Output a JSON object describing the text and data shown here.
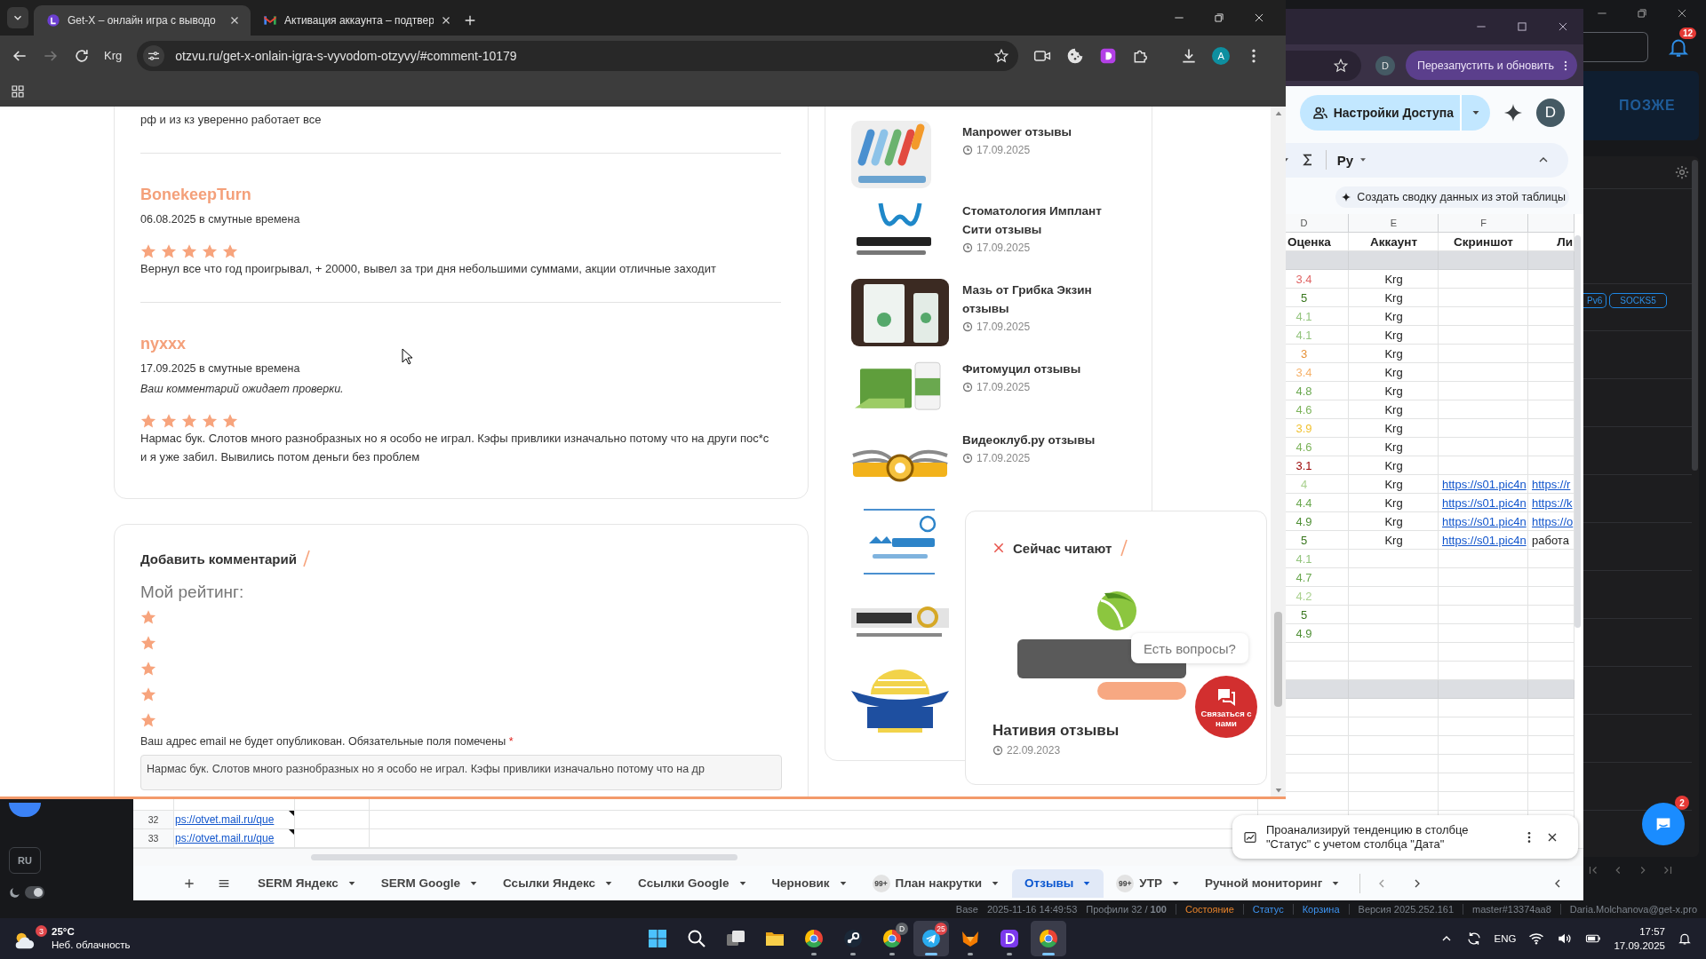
{
  "browser": {
    "tabs": [
      {
        "kind": "round",
        "title": "Get-X – онлайн игра с выводо",
        "selected": true
      },
      {
        "kind": "mail",
        "title": "Активация аккаунта – подтвер",
        "selected": false
      }
    ],
    "forward_disabled": true,
    "toolbar_label": "Krg",
    "address": "otzvu.ru/get-x-onlain-igra-s-vyvodom-otzyvy/#comment-10179",
    "avatar": "A"
  },
  "comments": [
    {
      "kind": "excerpt",
      "text": "рф и из кз уверенно работает все"
    },
    {
      "kind": "review",
      "author": "BonekeepTurn",
      "date": "06.08.2025 в смутные времена",
      "stars": 5,
      "text": "Вернул все что год проигрывал, + 20000, вывел за три дня небольшими суммами, акции отличные заходит"
    },
    {
      "kind": "review",
      "author": "nyxxx",
      "date": "17.09.2025 в смутные времена",
      "note": "Ваш комментарий ожидает проверки.",
      "stars": 5,
      "text": "Нармас бук. Слотов много разнобразных но я особо не играл. Кэфы привлики изначально потому что на други пос*с и я уже забил. Вывились потом деньги без проблем"
    }
  ],
  "comment_form": {
    "title": "Добавить комментарий",
    "rating_label": "Мой рейтинг:",
    "notice": "Ваш адрес email не будет опубликован. Обязательные поля помечены",
    "required_mark": "*",
    "comment_value": "Нармас бук. Слотов много разнобразных но я особо не играл. Кэфы привлики изначально потому что на др"
  },
  "sidebar": {
    "items": [
      {
        "kind": "stripes",
        "title": "Manpower отзывы",
        "date": "17.09.2025"
      },
      {
        "kind": "wave",
        "title": "Стоматология Имплант Сити отзывы",
        "date": "17.09.2025"
      },
      {
        "kind": "tubes",
        "title": "Мазь от Грибка Экзин отзывы",
        "date": "17.09.2025"
      },
      {
        "kind": "box",
        "title": "Фитомуцил отзывы",
        "date": "17.09.2025"
      },
      {
        "kind": "wings",
        "title": "Видеоклуб.ру отзывы",
        "date": "17.09.2025"
      },
      {
        "kind": "bubble"
      },
      {
        "kind": "banner"
      },
      {
        "kind": "dome"
      }
    ]
  },
  "reading_now": {
    "title": "Сейчас читают",
    "item_title": "Нативия отзывы",
    "date": "22.09.2023"
  },
  "chat_widget": {
    "prompt": "Есть вопросы?",
    "button": "Связаться с нами"
  },
  "sheets_window": {
    "update_button": "Перезапустить и обновить",
    "profile_avatar": "D",
    "share_button": "Настройки Доступа",
    "account_avatar": "D",
    "input_tools": "Ру",
    "summary_chip": "Создать сводку данных из этой таблицы",
    "column_letters": [
      "D",
      "E",
      "F"
    ],
    "headers": [
      "Оценка",
      "Аккаунт",
      "Скриншот",
      "Ли"
    ],
    "rows": [
      {
        "shaded": true
      },
      {
        "shaded": false,
        "score": "3.4",
        "color": "#e06666",
        "account": "Krg"
      },
      {
        "shaded": false,
        "score": "5",
        "color": "#38761d",
        "account": "Krg"
      },
      {
        "shaded": false,
        "score": "4.1",
        "color": "#93c47d",
        "account": "Krg"
      },
      {
        "shaded": false,
        "score": "4.1",
        "color": "#93c47d",
        "account": "Krg"
      },
      {
        "shaded": false,
        "score": "3",
        "color": "#e69138",
        "account": "Krg"
      },
      {
        "shaded": false,
        "score": "3.4",
        "color": "#f6b26b",
        "account": "Krg"
      },
      {
        "shaded": false,
        "score": "4.8",
        "color": "#6aa84f",
        "account": "Krg"
      },
      {
        "shaded": false,
        "score": "4.6",
        "color": "#7cb35a",
        "account": "Krg"
      },
      {
        "shaded": false,
        "score": "3.9",
        "color": "#f1c232",
        "account": "Krg"
      },
      {
        "shaded": false,
        "score": "4.6",
        "color": "#7cb35a",
        "account": "Krg"
      },
      {
        "shaded": false,
        "score": "3.1",
        "color": "#990000",
        "account": "Krg"
      },
      {
        "shaded": false,
        "score": "4",
        "color": "#a9d08e",
        "account": "Krg",
        "screenshot": "https://s01.pic4n",
        "link": "https://r"
      },
      {
        "shaded": false,
        "score": "4.4",
        "color": "#6aa84f",
        "account": "Krg",
        "screenshot": "https://s01.pic4n",
        "link": "https://k"
      },
      {
        "shaded": false,
        "score": "4.9",
        "color": "#4e8f34",
        "account": "Krg",
        "screenshot": "https://s01.pic4n",
        "link": "https://o"
      },
      {
        "shaded": false,
        "score": "5",
        "color": "#38761d",
        "account": "Krg",
        "screenshot": "https://s01.pic4n",
        "comment": "работа"
      },
      {
        "shaded": false,
        "score": "4.1",
        "color": "#93c47d"
      },
      {
        "shaded": false,
        "score": "4.7",
        "color": "#6aa84f"
      },
      {
        "shaded": false,
        "score": "4.2",
        "color": "#a9d08e"
      },
      {
        "shaded": false,
        "score": "5",
        "color": "#38761d"
      },
      {
        "shaded": false,
        "score": "4.9",
        "color": "#4e8f34"
      },
      {
        "shaded": false
      },
      {
        "shaded": false
      },
      {
        "shaded": true
      },
      {
        "shaded": false
      },
      {
        "shaded": false
      },
      {
        "shaded": false
      },
      {
        "shaded": false
      },
      {
        "shaded": false
      },
      {
        "shaded": false
      }
    ],
    "lower_rows": [
      {
        "number": "32",
        "link": "ps://otvet.mail.ru/que"
      },
      {
        "number": "33",
        "link": "ps://otvet.mail.ru/que"
      }
    ],
    "sheet_tabs": [
      {
        "label": "SERM Яндекс",
        "selected": false
      },
      {
        "label": "SERM Google",
        "selected": false
      },
      {
        "label": "Ссылки Яндекс",
        "selected": false
      },
      {
        "label": "Ссылки Google",
        "selected": false
      },
      {
        "label": "Черновик",
        "selected": false
      },
      {
        "label": "План накрутки",
        "badge": "99+",
        "selected": false
      },
      {
        "label": "Отзывы",
        "selected": true
      },
      {
        "label": "УТР",
        "badge": "99+",
        "selected": false
      },
      {
        "label": "Ручной мониторинг",
        "selected": false
      }
    ],
    "suggestion": "Проанализируй тенденцию в столбце \"Статус\" с учетом столбца \"Дата\""
  },
  "dark_app": {
    "notification_count": "12",
    "later_button": "ПОЗЖЕ",
    "tags": [
      "Pv6",
      "SOCKS5"
    ],
    "chat_badge": "2",
    "language_button": "RU",
    "theme_toggle_on": true,
    "status": [
      {
        "kind": "plain",
        "separated": false,
        "text": "Base"
      },
      {
        "kind": "plain",
        "separated": false,
        "text": "2025-11-16 14:49:53"
      },
      {
        "kind": "plain",
        "separated": false,
        "text": "Профили 32 / **100**"
      },
      {
        "kind": "warn",
        "separated": true,
        "text": "Состояние"
      },
      {
        "kind": "link",
        "separated": true,
        "text": "Статус"
      },
      {
        "kind": "link",
        "separated": true,
        "text": "Корзина"
      },
      {
        "kind": "plain",
        "separated": true,
        "text": "Версия 2025.252.161"
      },
      {
        "kind": "plain",
        "separated": true,
        "text": "master#13374aa8"
      },
      {
        "kind": "plain",
        "separated": true,
        "text": "Daria.Molchanova@get-x.pro"
      }
    ]
  },
  "taskbar": {
    "weather": {
      "alerts": "3",
      "temperature": "25°C",
      "condition": "Неб. облачность"
    },
    "apps": [
      {
        "kind": "start",
        "open": false,
        "selected": false
      },
      {
        "kind": "search",
        "open": false,
        "selected": false
      },
      {
        "kind": "tasks",
        "open": false,
        "selected": false
      },
      {
        "kind": "folder",
        "open": false,
        "selected": false
      },
      {
        "kind": "chrome",
        "open": true,
        "selected": false
      },
      {
        "kind": "steam",
        "open": true,
        "selected": false
      },
      {
        "kind": "chrome",
        "open": true,
        "selected": false,
        "badge": {
          "text": "D",
          "color": "#5f6368"
        }
      },
      {
        "kind": "telegram",
        "open": true,
        "selected": true,
        "badge": {
          "text": "25",
          "color": "#e0464a"
        }
      },
      {
        "kind": "fox",
        "open": true,
        "selected": false
      },
      {
        "kind": "square",
        "open": true,
        "selected": false
      },
      {
        "kind": "chrome",
        "open": true,
        "selected": true
      }
    ],
    "tray": {
      "language": "ENG",
      "time": "17:57",
      "date": "17.09.2025"
    }
  }
}
